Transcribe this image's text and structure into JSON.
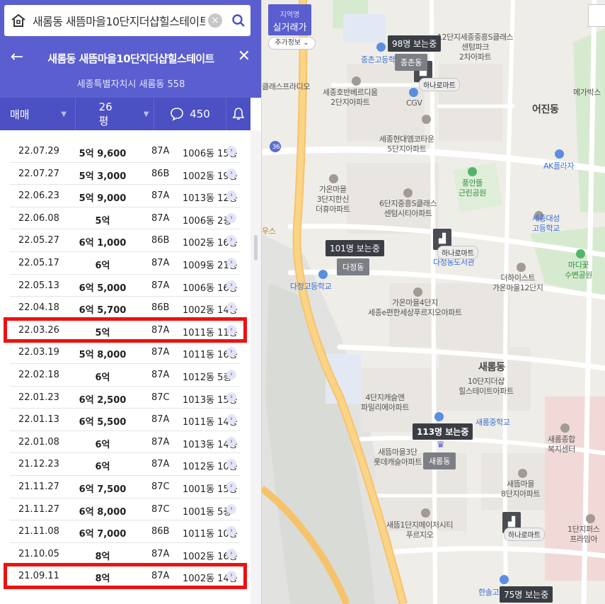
{
  "search": {
    "query": "새롬동 새뜸마을10단지더샵힐스테이트"
  },
  "header": {
    "title": "새롬동 새뜸마을10단지더샵힐스테이트",
    "address": "세종특별자치시 새롬동 558"
  },
  "filters": {
    "type": "매매",
    "size": "26평",
    "comments": "450"
  },
  "transactions": [
    {
      "date": "22.07.29",
      "price": "5억 9,600",
      "type": "87A",
      "floor": "1006동 15층",
      "hl": false
    },
    {
      "date": "22.07.27",
      "price": "5억 3,000",
      "type": "86B",
      "floor": "1002동 19층",
      "hl": false
    },
    {
      "date": "22.06.23",
      "price": "5억 9,000",
      "type": "87A",
      "floor": "1013동 12층",
      "hl": false
    },
    {
      "date": "22.06.08",
      "price": "5억",
      "type": "87A",
      "floor": "1006동 2층",
      "hl": false
    },
    {
      "date": "22.05.27",
      "price": "6억 1,000",
      "type": "86B",
      "floor": "1002동 16층",
      "hl": false
    },
    {
      "date": "22.05.17",
      "price": "6억",
      "type": "87A",
      "floor": "1009동 21층",
      "hl": false
    },
    {
      "date": "22.05.13",
      "price": "6억 5,000",
      "type": "87A",
      "floor": "1006동 16층",
      "hl": false
    },
    {
      "date": "22.04.18",
      "price": "6억 5,700",
      "type": "86B",
      "floor": "1002동 14층",
      "hl": false
    },
    {
      "date": "22.03.26",
      "price": "5억",
      "type": "87A",
      "floor": "1011동 11층",
      "hl": true
    },
    {
      "date": "22.03.19",
      "price": "5억 8,000",
      "type": "87A",
      "floor": "1011동 16층",
      "hl": false
    },
    {
      "date": "22.02.18",
      "price": "6억",
      "type": "87A",
      "floor": "1012동 5층",
      "hl": false
    },
    {
      "date": "22.01.23",
      "price": "6억 2,500",
      "type": "87C",
      "floor": "1013동 15층",
      "hl": false
    },
    {
      "date": "22.01.13",
      "price": "6억 5,500",
      "type": "87A",
      "floor": "1011동 14층",
      "hl": false
    },
    {
      "date": "22.01.08",
      "price": "6억",
      "type": "87A",
      "floor": "1013동 14층",
      "hl": false
    },
    {
      "date": "21.12.23",
      "price": "6억",
      "type": "87A",
      "floor": "1012동 10층",
      "hl": false
    },
    {
      "date": "21.11.27",
      "price": "6억 7,500",
      "type": "87C",
      "floor": "1001동 15층",
      "hl": false
    },
    {
      "date": "21.11.27",
      "price": "6억 8,000",
      "type": "87C",
      "floor": "1001동 5층",
      "hl": false
    },
    {
      "date": "21.11.08",
      "price": "6억 7,000",
      "type": "86B",
      "floor": "1011동 10층",
      "hl": false
    },
    {
      "date": "21.10.05",
      "price": "8억",
      "type": "87A",
      "floor": "1002동 16층",
      "hl": false
    },
    {
      "date": "21.09.11",
      "price": "8억",
      "type": "87A",
      "floor": "1002동 14층",
      "hl": true
    }
  ],
  "map": {
    "silgeo_top": "지역명",
    "silgeo_bottom": "실거래가",
    "extra_info": "추가정보",
    "bubbles": {
      "jongchon": "98명 보는중",
      "dajeong": "101명 보는중",
      "saerom": "113명 보는중",
      "bottom": "75명 보는중"
    },
    "dongs": {
      "jongchon": "종촌동",
      "dajeong": "다정동",
      "saerom": "새롬동"
    },
    "labels": {
      "l1": "12단지세종중흥S클래스\n센텀파크\n2차아파트",
      "l2": "종촌고등학",
      "l3": "클래스프라디오",
      "l4": "세종호반베르디움\n2단지아파트",
      "l5": "CGV",
      "l6": "어진동",
      "l7": "메가박스",
      "l8": "세종현대엠코타운\n5단지아파트",
      "l9": "AK플라자",
      "l10": "풍안뜰\n근린공원",
      "l11": "가온마을\n3단지한신\n더휴아파트",
      "l12": "6단지중흥S클래스\n센텀시티아파트",
      "l13": "세종대성\n고등학교",
      "l14": "다정동도서관",
      "l15": "마디꽃\n수변공원",
      "l16": "다정고등학교",
      "l17": "더하이스트\n가온마을12단지",
      "l18": "가온마을4단지\n세종e편한세상푸르지오아파트",
      "l19": "새롬동",
      "l20": "10단지더샵\n힐스테이트아파트",
      "l21": "4단지캐슬앤\n파밀리에아파트",
      "l22": "새롬중학교",
      "l23": "새롬종합\n복지센터",
      "l24": "새뜸마을3단\n롯데캐슬아파트",
      "l25": "새뜸마을\n8단지아파트",
      "l26": "새뜸1단지메이저시티\n푸르지오",
      "l27": "1단지퍼스\n프라임아",
      "l28": "한솔고",
      "l29": "우스",
      "l30": "36"
    },
    "marts": {
      "m1": "하나로마트",
      "m2": "하나로마트",
      "m3": "하나로마트"
    }
  }
}
